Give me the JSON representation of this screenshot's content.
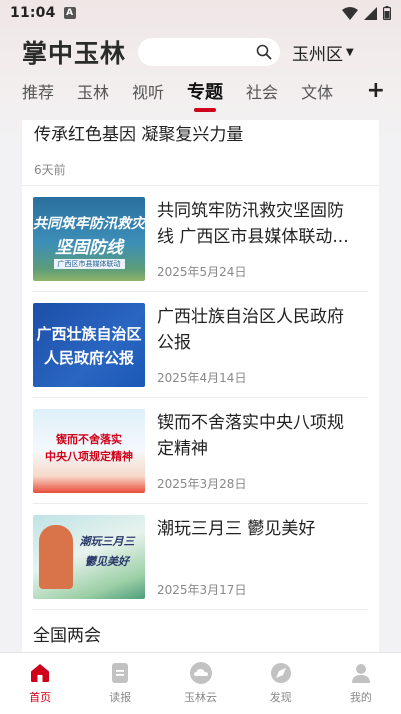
{
  "status_bar": {
    "time": "11:04",
    "notification_badge": "A"
  },
  "header": {
    "logo": "掌中玉林",
    "region": "玉州区"
  },
  "tabs": [
    {
      "label": "推荐",
      "active": false
    },
    {
      "label": "玉林",
      "active": false
    },
    {
      "label": "视听",
      "active": false
    },
    {
      "label": "专题",
      "active": true
    },
    {
      "label": "社会",
      "active": false
    },
    {
      "label": "文体",
      "active": false
    }
  ],
  "feed": {
    "top_item": {
      "title": "传承红色基因 凝聚复兴力量",
      "time": "6天前"
    },
    "items": [
      {
        "title": "共同筑牢防汛救灾坚固防线 广西区市县媒体联动...",
        "date": "2025年5月24日",
        "thumb_lines": [
          "共同筑牢防汛救灾",
          "坚固防线"
        ],
        "thumb_caption": "广西区市县媒体联动"
      },
      {
        "title": "广西壮族自治区人民政府公报",
        "date": "2025年4月14日",
        "thumb_lines": [
          "广西壮族自治区",
          "人民政府公报"
        ]
      },
      {
        "title": "锲而不舍落实中央八项规定精神",
        "date": "2025年3月28日",
        "thumb_lines": [
          "锲而不舍落实",
          "中央八项规定精神"
        ]
      },
      {
        "title": "潮玩三月三 鬱见美好",
        "date": "2025年3月17日",
        "thumb_lines": [
          "潮玩三月三",
          "鬱见美好"
        ]
      }
    ],
    "bottom_item": {
      "title": "全国两会"
    }
  },
  "bottom_nav": [
    {
      "label": "首页",
      "icon": "home-icon",
      "active": true
    },
    {
      "label": "读报",
      "icon": "newspaper-icon",
      "active": false
    },
    {
      "label": "玉林云",
      "icon": "cloud-icon",
      "active": false
    },
    {
      "label": "发现",
      "icon": "discover-icon",
      "active": false
    },
    {
      "label": "我的",
      "icon": "profile-icon",
      "active": false
    }
  ],
  "colors": {
    "accent": "#d0021b",
    "inactive": "#c2c2c2"
  }
}
